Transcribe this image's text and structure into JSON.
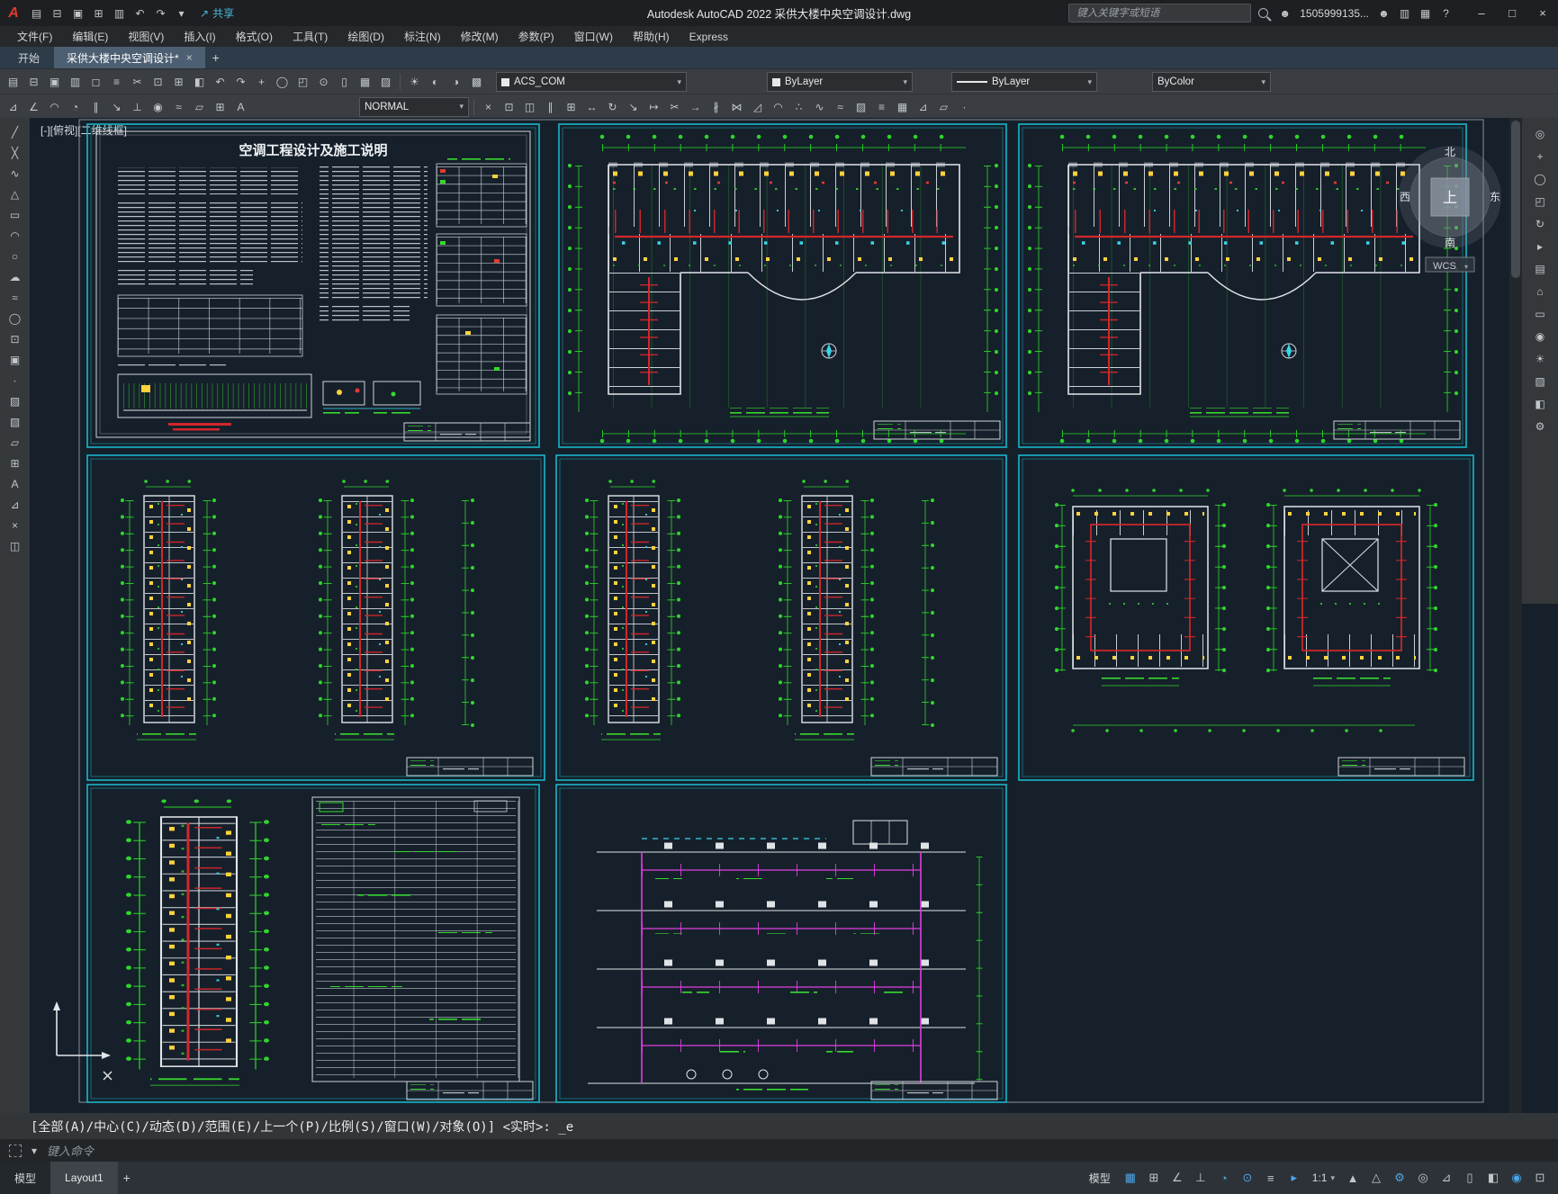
{
  "ui": {
    "caret": "▾"
  },
  "titlebar": {
    "logo": "A",
    "quick_icons": [
      {
        "name": "new-drawing-icon",
        "glyph": "▤"
      },
      {
        "name": "open-drawing-icon",
        "glyph": "⊟"
      },
      {
        "name": "save-icon",
        "glyph": "▣"
      },
      {
        "name": "save-as-icon",
        "glyph": "⊞"
      },
      {
        "name": "plot-icon",
        "glyph": "▥"
      },
      {
        "name": "undo-icon",
        "glyph": "↶"
      },
      {
        "name": "redo-icon",
        "glyph": "↷"
      },
      {
        "name": "quick-access-dropdown-icon",
        "glyph": "▾"
      }
    ],
    "share_label": "共享",
    "share_glyph": "↗",
    "title": "Autodesk AutoCAD 2022   采供大楼中央空调设计.dwg",
    "search_placeholder": "键入关键字或短语",
    "account": "1505999135...",
    "right_icons": [
      {
        "name": "user-icon",
        "glyph": "☻"
      },
      {
        "name": "cart-icon",
        "glyph": "▥"
      },
      {
        "name": "apps-icon",
        "glyph": "▦"
      },
      {
        "name": "help-icon",
        "glyph": "?"
      }
    ],
    "window_controls": [
      {
        "name": "minimize-button",
        "glyph": "–"
      },
      {
        "name": "maximize-button",
        "glyph": "□"
      },
      {
        "name": "close-button",
        "glyph": "×"
      }
    ]
  },
  "menubar": {
    "items": [
      {
        "name": "menu-file",
        "label": "文件(F)"
      },
      {
        "name": "menu-edit",
        "label": "编辑(E)"
      },
      {
        "name": "menu-view",
        "label": "视图(V)"
      },
      {
        "name": "menu-insert",
        "label": "插入(I)"
      },
      {
        "name": "menu-format",
        "label": "格式(O)"
      },
      {
        "name": "menu-tools",
        "label": "工具(T)"
      },
      {
        "name": "menu-draw",
        "label": "绘图(D)"
      },
      {
        "name": "menu-dimension",
        "label": "标注(N)"
      },
      {
        "name": "menu-modify",
        "label": "修改(M)"
      },
      {
        "name": "menu-parametric",
        "label": "参数(P)"
      },
      {
        "name": "menu-window",
        "label": "窗口(W)"
      },
      {
        "name": "menu-help",
        "label": "帮助(H)"
      },
      {
        "name": "menu-express",
        "label": "Express"
      }
    ]
  },
  "filetabs": {
    "start": "开始",
    "drawing": "采供大楼中央空调设计*",
    "close": "×",
    "add": "+"
  },
  "toolbar1": {
    "icons": [
      {
        "name": "qnew-icon",
        "glyph": "▤"
      },
      {
        "name": "open-icon",
        "glyph": "⊟"
      },
      {
        "name": "save-file-icon",
        "glyph": "▣"
      },
      {
        "name": "plot-tool-icon",
        "glyph": "▥"
      },
      {
        "name": "plot-preview-icon",
        "glyph": "◻"
      },
      {
        "name": "publish-icon",
        "glyph": "≡"
      },
      {
        "name": "cut-icon",
        "glyph": "✂"
      },
      {
        "name": "copy-icon",
        "glyph": "⊡"
      },
      {
        "name": "paste-icon",
        "glyph": "⊞"
      },
      {
        "name": "match-properties-icon",
        "glyph": "◧"
      },
      {
        "name": "undo-tool-icon",
        "glyph": "↶"
      },
      {
        "name": "redo-tool-icon",
        "glyph": "↷"
      },
      {
        "name": "pan-tool-icon",
        "glyph": "+"
      },
      {
        "name": "zoom-realtime-icon",
        "glyph": "◯"
      },
      {
        "name": "zoom-window-icon",
        "glyph": "◰"
      },
      {
        "name": "zoom-previous-icon",
        "glyph": "⊙"
      },
      {
        "name": "properties-icon",
        "glyph": "▯"
      },
      {
        "name": "design-center-icon",
        "glyph": "▦"
      },
      {
        "name": "tool-palettes-icon",
        "glyph": "▨"
      }
    ],
    "layer_icons": [
      {
        "name": "layer-on-icon",
        "glyph": "☀"
      },
      {
        "name": "layer-freeze-icon",
        "glyph": "◐"
      },
      {
        "name": "layer-lock-icon",
        "glyph": "◑"
      },
      {
        "name": "layer-properties-icon",
        "glyph": "▩"
      }
    ],
    "layer_value": "ACS_COM",
    "color_value": "ByLayer",
    "linetype_value": "ByLayer",
    "lineweight_value": "ByColor"
  },
  "toolbar2": {
    "left_icons": [
      {
        "name": "dim-linear-icon",
        "glyph": "⊿"
      },
      {
        "name": "dim-angular-icon",
        "glyph": "∠"
      },
      {
        "name": "dim-arc-icon",
        "glyph": "◠"
      },
      {
        "name": "dim-radius-icon",
        "glyph": "◔"
      },
      {
        "name": "dim-baseline-icon",
        "glyph": "∥"
      },
      {
        "name": "leader-icon",
        "glyph": "↘"
      },
      {
        "name": "tolerance-icon",
        "glyph": "⊥"
      },
      {
        "name": "center-mark-icon",
        "glyph": "◉"
      },
      {
        "name": "dim-edit-icon",
        "glyph": "≈"
      },
      {
        "name": "dim-style-icon",
        "glyph": "▱"
      },
      {
        "name": "table-style-icon",
        "glyph": "⊞"
      },
      {
        "name": "text-style-icon",
        "glyph": "A"
      }
    ],
    "style_value": "NORMAL",
    "right_icons": [
      {
        "name": "erase-icon",
        "glyph": "×"
      },
      {
        "name": "copy-object-icon",
        "glyph": "⊡"
      },
      {
        "name": "mirror-icon",
        "glyph": "◫"
      },
      {
        "name": "offset-icon",
        "glyph": "∥"
      },
      {
        "name": "array-icon",
        "glyph": "⊞"
      },
      {
        "name": "move-icon",
        "glyph": "↔"
      },
      {
        "name": "rotate-icon",
        "glyph": "↻"
      },
      {
        "name": "scale-icon",
        "glyph": "↘"
      },
      {
        "name": "stretch-icon",
        "glyph": "↦"
      },
      {
        "name": "trim-icon",
        "glyph": "✂"
      },
      {
        "name": "extend-icon",
        "glyph": "→"
      },
      {
        "name": "break-icon",
        "glyph": "∦"
      },
      {
        "name": "join-icon",
        "glyph": "⋈"
      },
      {
        "name": "chamfer-icon",
        "glyph": "◿"
      },
      {
        "name": "fillet-icon",
        "glyph": "◠"
      },
      {
        "name": "explode-icon",
        "glyph": "∴"
      },
      {
        "name": "polyline-edit-icon",
        "glyph": "∿"
      },
      {
        "name": "spline-edit-icon",
        "glyph": "≈"
      },
      {
        "name": "hatch-edit-icon",
        "glyph": "▨"
      },
      {
        "name": "align-icon",
        "glyph": "≡"
      },
      {
        "name": "group-icon",
        "glyph": "▦"
      },
      {
        "name": "measure-icon",
        "glyph": "⊿"
      },
      {
        "name": "region-edit-icon",
        "glyph": "▱"
      },
      {
        "name": "point-style-icon",
        "glyph": "∙"
      }
    ]
  },
  "left_toolbar": {
    "icons": [
      {
        "name": "line-tool-icon",
        "glyph": "╱"
      },
      {
        "name": "construction-line-tool-icon",
        "glyph": "╳"
      },
      {
        "name": "polyline-tool-icon",
        "glyph": "∿"
      },
      {
        "name": "polygon-tool-icon",
        "glyph": "△"
      },
      {
        "name": "rectangle-tool-icon",
        "glyph": "▭"
      },
      {
        "name": "arc-tool-icon",
        "glyph": "◠"
      },
      {
        "name": "circle-tool-icon",
        "glyph": "○"
      },
      {
        "name": "revision-cloud-tool-icon",
        "glyph": "☁"
      },
      {
        "name": "spline-tool-icon",
        "glyph": "≈"
      },
      {
        "name": "ellipse-tool-icon",
        "glyph": "◯"
      },
      {
        "name": "insert-block-tool-icon",
        "glyph": "⊡"
      },
      {
        "name": "create-block-tool-icon",
        "glyph": "▣"
      },
      {
        "name": "point-tool-icon",
        "glyph": "∙"
      },
      {
        "name": "hatch-tool-icon",
        "glyph": "▨"
      },
      {
        "name": "gradient-tool-icon",
        "glyph": "▧"
      },
      {
        "name": "region-tool-icon",
        "glyph": "▱"
      },
      {
        "name": "table-tool-icon",
        "glyph": "⊞"
      },
      {
        "name": "mtext-tool-icon",
        "glyph": "A"
      },
      {
        "name": "dimension-tool-icon",
        "glyph": "⊿"
      },
      {
        "name": "erase-tool-icon",
        "glyph": "×"
      },
      {
        "name": "mirror-tool-icon",
        "glyph": "◫"
      }
    ]
  },
  "right_toolbar": {
    "icons": [
      {
        "name": "navigation-wheel-icon",
        "glyph": "◎"
      },
      {
        "name": "pan-icon",
        "glyph": "+"
      },
      {
        "name": "zoom-extents-icon",
        "glyph": "◯"
      },
      {
        "name": "zoom-window-nav-icon",
        "glyph": "◰"
      },
      {
        "name": "orbit-icon",
        "glyph": "↻"
      },
      {
        "name": "show-motion-icon",
        "glyph": "▸"
      },
      {
        "name": "layer-walk-icon",
        "glyph": "▤"
      },
      {
        "name": "named-views-icon",
        "glyph": "⌂"
      },
      {
        "name": "section-plane-icon",
        "glyph": "▭"
      },
      {
        "name": "camera-icon",
        "glyph": "◉"
      },
      {
        "name": "sun-properties-icon",
        "glyph": "☀"
      },
      {
        "name": "materials-icon",
        "glyph": "▨"
      },
      {
        "name": "render-icon",
        "glyph": "◧"
      },
      {
        "name": "nav-settings-icon",
        "glyph": "⚙"
      }
    ]
  },
  "canvas": {
    "viewport_control": "[-][俯视][二维线框]",
    "notes_title": "空调工程设计及施工说明",
    "compass": {
      "north": "北",
      "south": "南",
      "east": "东",
      "west": "西",
      "up": "上",
      "wcs": "WCS"
    }
  },
  "commandline": {
    "prompt": "[全部(A)/中心(C)/动态(D)/范围(E)/上一个(P)/比例(S)/窗口(W)/对象(O)] <实时>: _e",
    "input_placeholder": "键入命令"
  },
  "statusbar": {
    "model_tab": "模型",
    "layout_tab": "Layout1",
    "add_tab": "+",
    "model_button": "模型",
    "scale": "1:1",
    "icons_a": [
      {
        "name": "grid-icon",
        "glyph": "▦",
        "accent": true
      },
      {
        "name": "snap-icon",
        "glyph": "⊞"
      },
      {
        "name": "infer-constraints-icon",
        "glyph": "∠"
      },
      {
        "name": "ortho-icon",
        "glyph": "⊥"
      },
      {
        "name": "polar-tracking-icon",
        "glyph": "◔",
        "accent": true
      },
      {
        "name": "osnap-icon",
        "glyph": "⊙",
        "accent": true
      },
      {
        "name": "lineweight-display-icon",
        "glyph": "≡"
      },
      {
        "name": "dynamic-input-icon",
        "glyph": "▸",
        "accent": true
      }
    ],
    "icons_b": [
      {
        "name": "annotation-visibility-icon",
        "glyph": "▲"
      },
      {
        "name": "autoscale-icon",
        "glyph": "△"
      },
      {
        "name": "workspace-gear-icon",
        "glyph": "⚙",
        "accent": true
      },
      {
        "name": "annotation-monitor-icon",
        "glyph": "◎"
      },
      {
        "name": "units-icon",
        "glyph": "⊿"
      },
      {
        "name": "quick-properties-icon",
        "glyph": "▯"
      },
      {
        "name": "isolate-objects-icon",
        "glyph": "◧"
      },
      {
        "name": "graphics-performance-icon",
        "glyph": "◉",
        "accent": true
      },
      {
        "name": "clean-screen-icon",
        "glyph": "⊡"
      }
    ]
  }
}
